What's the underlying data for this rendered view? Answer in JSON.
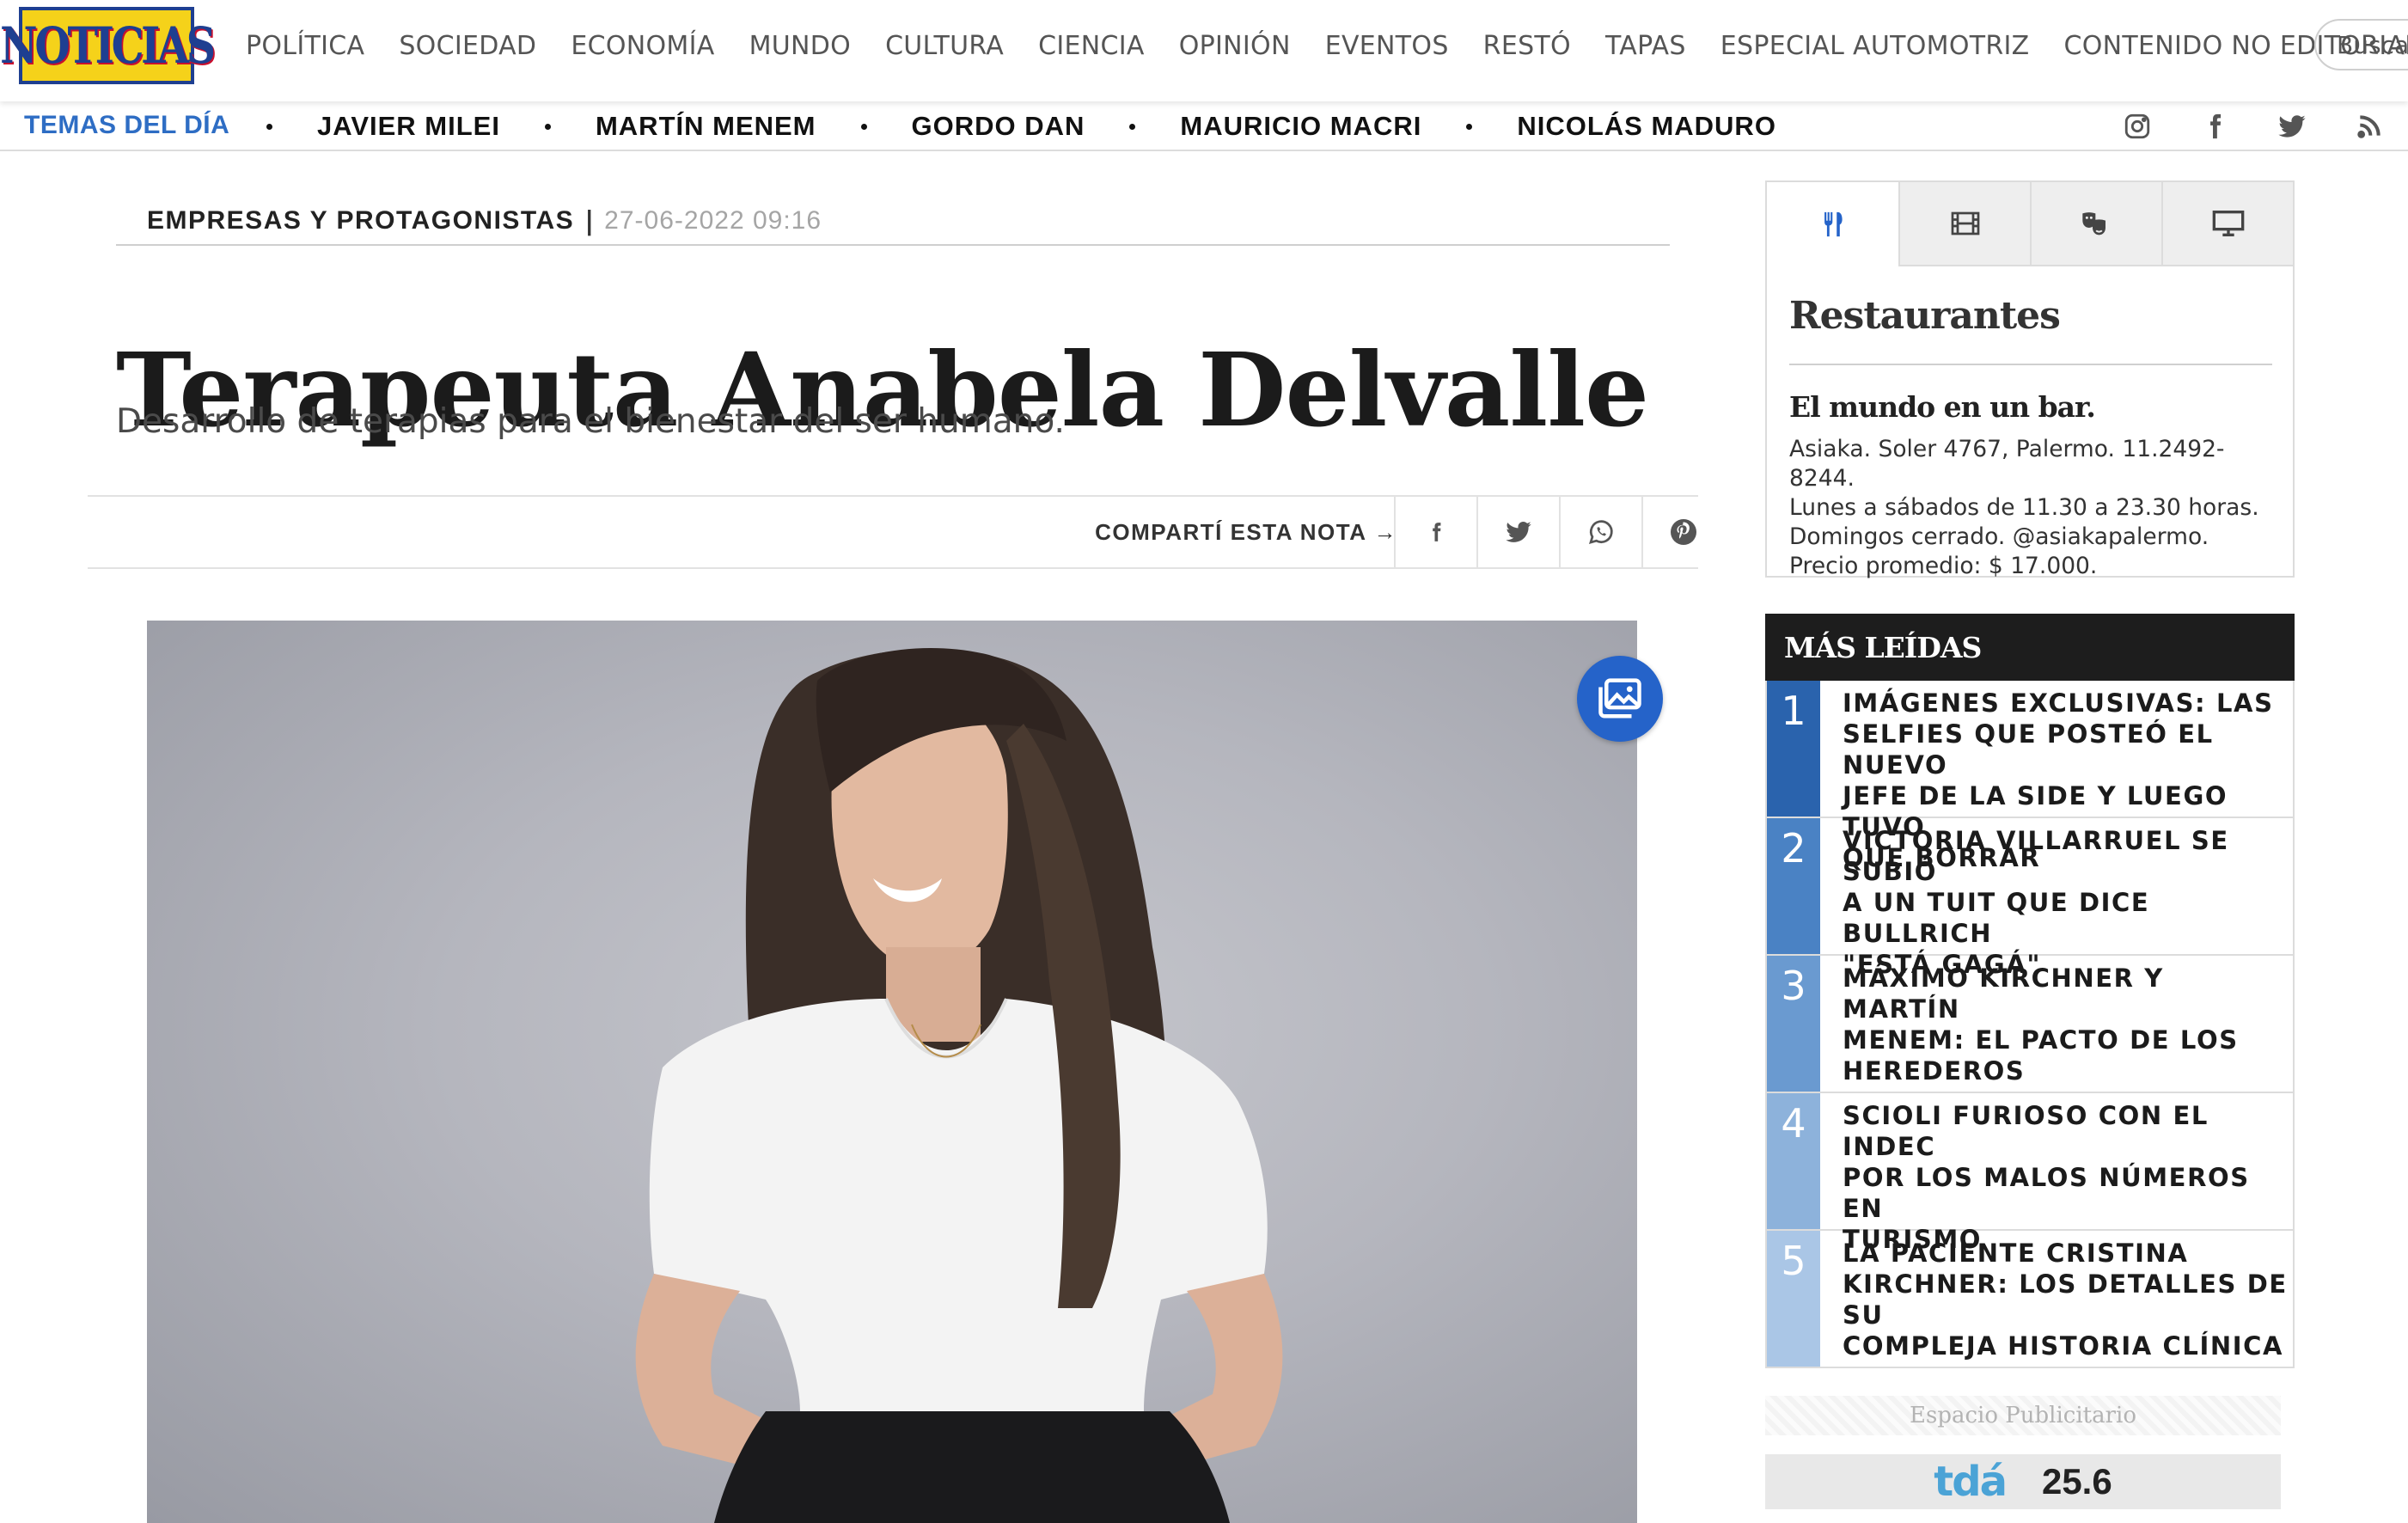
{
  "brand": {
    "logo_text": "NOTICIAS"
  },
  "nav": {
    "items": [
      "POLÍTICA",
      "SOCIEDAD",
      "ECONOMÍA",
      "MUNDO",
      "CULTURA",
      "CIENCIA",
      "OPINIÓN",
      "EVENTOS",
      "RESTÓ",
      "TAPAS",
      "ESPECIAL AUTOMOTRIZ",
      "CONTENIDO NO EDITORIAL"
    ],
    "search_placeholder": "Buscar"
  },
  "subnav": {
    "label": "TEMAS DEL DÍA",
    "topics": [
      "JAVIER MILEI",
      "MARTÍN MENEM",
      "GORDO DAN",
      "MAURICIO MACRI",
      "NICOLÁS MADURO"
    ],
    "social_icons": [
      "instagram-icon",
      "facebook-icon",
      "twitter-icon",
      "rss-icon"
    ]
  },
  "article": {
    "section": "EMPRESAS Y PROTAGONISTAS",
    "separator": "|",
    "date": "27-06-2022 09:16",
    "title": "Terapeuta Anabela Delvalle",
    "subtitle": "Desarrollo de terapias para el bienestar del ser humano.",
    "share_label": "COMPARTÍ ESTA NOTA",
    "share_arrow": "→",
    "share_icons": [
      "facebook-icon",
      "twitter-icon",
      "whatsapp-icon",
      "pinterest-icon"
    ]
  },
  "sidebar": {
    "widget": {
      "tabs": [
        "restaurant-icon",
        "film-icon",
        "theater-masks-icon",
        "monitor-icon"
      ],
      "title": "Restaurantes",
      "subtitle": "El mundo en un bar.",
      "body_lines": [
        "Asiaka. Soler 4767, Palermo. 11.2492-8244.",
        "Lunes a sábados de 11.30 a 23.30 horas.",
        "Domingos cerrado. @asiakapalermo.",
        "Precio promedio: $ 17.000."
      ]
    },
    "mas_leidas": {
      "title": "MÁS LEÍDAS",
      "items": [
        {
          "num": "1",
          "lines": [
            "IMÁGENES EXCLUSIVAS: LAS",
            "SELFIES QUE POSTEÓ EL NUEVO",
            "JEFE DE LA SIDE Y LUEGO TUVO",
            "QUE BORRAR"
          ],
          "color": "#2a63ad"
        },
        {
          "num": "2",
          "lines": [
            "VICTORIA VILLARRUEL SE SUBIÓ",
            "A UN TUIT QUE DICE BULLRICH",
            "\"ESTÁ GAGÁ\""
          ],
          "color": "#4a82c4"
        },
        {
          "num": "3",
          "lines": [
            "MÁXIMO KIRCHNER Y MARTÍN",
            "MENEM: EL PACTO DE LOS",
            "HEREDEROS"
          ],
          "color": "#6a9ad0"
        },
        {
          "num": "4",
          "lines": [
            "SCIOLI FURIOSO CON EL INDEC",
            "POR LOS MALOS NÚMEROS EN",
            "TURISMO"
          ],
          "color": "#8db2db"
        },
        {
          "num": "5",
          "lines": [
            "LA PACIENTE CRISTINA",
            "KIRCHNER: LOS DETALLES DE SU",
            "COMPLEJA HISTORIA CLÍNICA"
          ],
          "color": "#aac6e6"
        }
      ]
    },
    "ad": {
      "label": "Espacio Publicitario",
      "logo": "tdá",
      "channel": "25.6"
    }
  }
}
